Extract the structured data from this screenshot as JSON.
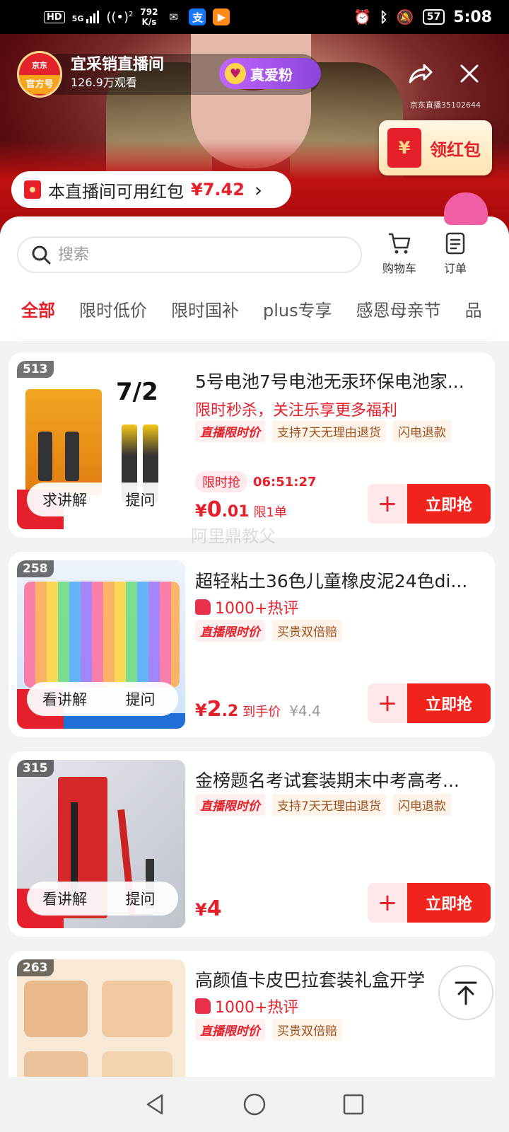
{
  "status_bar": {
    "hd": "HD",
    "network": "5G",
    "hotspot_count": "2",
    "speed_value": "792",
    "speed_unit": "K/s",
    "battery": "57",
    "time": "5:08"
  },
  "live": {
    "anchor_brand": "京东",
    "official_badge": "官方号",
    "anchor_name": "宜采销直播间",
    "viewers": "126.9万观看",
    "fan_label": "真爱粉",
    "room_id": "京东直播35102644",
    "red_packet_label": "领红包",
    "coupon_text": "本直播间可用红包",
    "coupon_amount": "¥7.42"
  },
  "panel": {
    "search_placeholder": "搜索",
    "cart_label": "购物车",
    "orders_label": "订单",
    "tabs": [
      "全部",
      "限时低价",
      "限时国补",
      "plus专享",
      "感恩母亲节",
      "品"
    ]
  },
  "products": [
    {
      "rank": "513",
      "ask_a": "求讲解",
      "ask_b": "提问",
      "title": "5号电池7号电池无汞环保电池家...",
      "subtitle": "限时秒杀，关注乐享更多福利",
      "tags": [
        "直播限时价",
        "支持7天无理由退货",
        "闪电退款"
      ],
      "flash_label": "限时抢",
      "flash_time": "06:51:27",
      "price_symbol": "¥",
      "price_int": "0",
      "price_dec": ".01",
      "price_note": "限1单",
      "buy_label": "立即抢"
    },
    {
      "rank": "258",
      "ask_a": "看讲解",
      "ask_b": "提问",
      "title": "超轻粘土36色儿童橡皮泥24色di...",
      "hot_label": "1000+热评",
      "tags": [
        "直播限时价",
        "买贵双倍赔"
      ],
      "price_symbol": "¥",
      "price_int": "2",
      "price_dec": ".2",
      "price_note": "到手价",
      "old_price": "¥4.4",
      "buy_label": "立即抢"
    },
    {
      "rank": "315",
      "ask_a": "看讲解",
      "ask_b": "提问",
      "title": "金榜题名考试套装期末中考高考...",
      "tags": [
        "直播限时价",
        "支持7天无理由退货",
        "闪电退款"
      ],
      "price_symbol": "¥",
      "price_int": "4",
      "buy_label": "立即抢"
    },
    {
      "rank": "263",
      "title": "高颜值卡皮巴拉套装礼盒开学",
      "hot_label": "1000+热评",
      "tags": [
        "直播限时价",
        "买贵双倍赔"
      ]
    }
  ],
  "watermark": "阿里鼎教父",
  "colors": {
    "accent": "#e5202b",
    "buy": "#f0231d",
    "fan": "#8b45d8"
  }
}
